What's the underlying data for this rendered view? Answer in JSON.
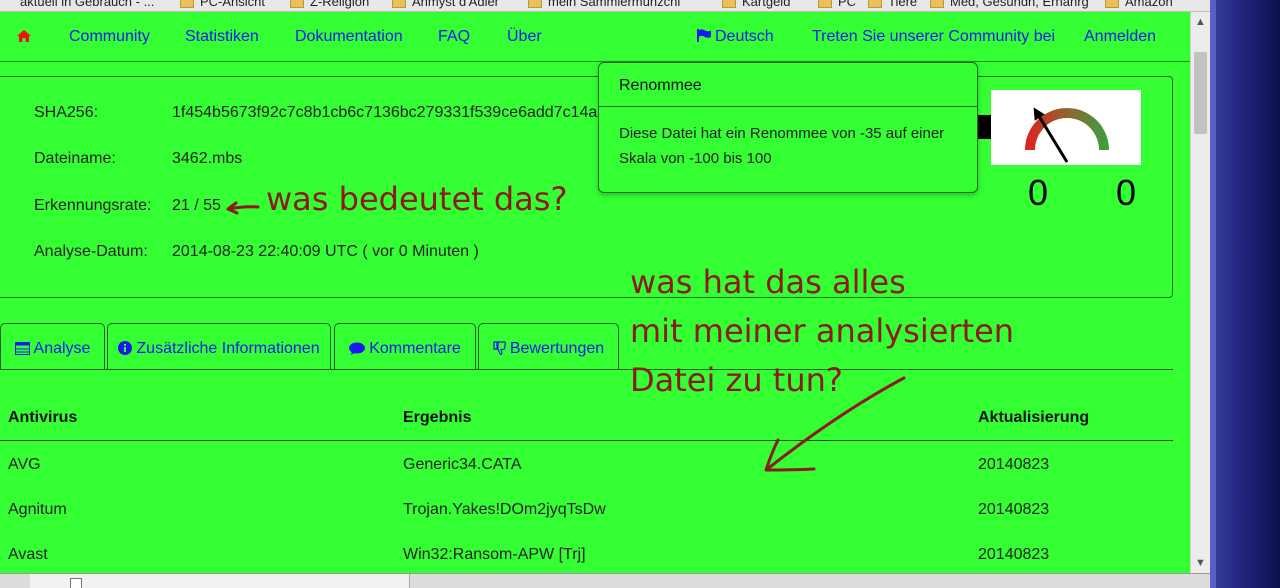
{
  "bookmarks": [
    {
      "label": "aktuell in Gebrauch - ..."
    },
    {
      "label": "PC-Ansicht"
    },
    {
      "label": "Z-Religion"
    },
    {
      "label": "Anmyst d'Adler"
    },
    {
      "label": "mein Sammlermünzchi"
    },
    {
      "label": "Kartgeld"
    },
    {
      "label": "PC"
    },
    {
      "label": "Tiere"
    },
    {
      "label": "Med, Gesundh, Ernährg"
    },
    {
      "label": "Amazon"
    }
  ],
  "nav": {
    "community": "Community",
    "statistics": "Statistiken",
    "documentation": "Dokumentation",
    "faq": "FAQ",
    "about": "Über",
    "language": "Deutsch",
    "join": "Treten Sie unserer Community bei",
    "login": "Anmelden"
  },
  "info": {
    "sha_label": "SHA256:",
    "sha_value": "1f454b5673f92c7c8b1cb6c7136bc279331f539ce6add7c14a",
    "filename_label": "Dateiname:",
    "filename_value": "3462.mbs",
    "detection_label": "Erkennungsrate:",
    "detection_value": "21 / 55",
    "date_label": "Analyse-Datum:",
    "date_value": "2014-08-23 22:40:09 UTC ( vor 0 Minuten )"
  },
  "reputation": {
    "title": "Renommee",
    "body": "Diese Datei hat ein Renommee von -35 auf einer Skala von -100 bis 100",
    "gauge_value": -35,
    "gauge_min": -100,
    "gauge_max": 100,
    "score_left": "0",
    "score_right": "0"
  },
  "tabs": [
    {
      "label": "Analyse",
      "icon": "table-icon"
    },
    {
      "label": "Zusätzliche Informationen",
      "icon": "info-icon"
    },
    {
      "label": "Kommentare",
      "icon": "comment-icon"
    },
    {
      "label": "Bewertungen",
      "icon": "thumbs-down-icon"
    }
  ],
  "table": {
    "headers": [
      "Antivirus",
      "Ergebnis",
      "Aktualisierung"
    ],
    "rows": [
      [
        "AVG",
        "Generic34.CATA",
        "20140823"
      ],
      [
        "Agnitum",
        "Trojan.Yakes!DOm2jyqTsDw",
        "20140823"
      ],
      [
        "Avast",
        "Win32:Ransom-APW [Trj]",
        "20140823"
      ]
    ]
  },
  "annotations": {
    "question1": "was bedeutet das?",
    "question2_line1": "was hat das alles",
    "question2_line2": "mit meiner analysierten",
    "question2_line3": "Datei zu tun?"
  },
  "colors": {
    "page_background": "#33ff33",
    "link": "#1a1aee",
    "annotation": "#8b1a1a"
  }
}
